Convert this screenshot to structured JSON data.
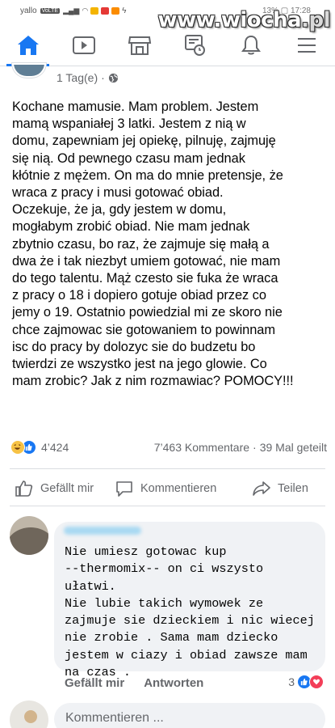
{
  "status_bar": {
    "carrier": "yallo",
    "network_badge": "VoLTE",
    "time": "13% ▢ 17:28"
  },
  "watermark": {
    "text": "www.wiocha",
    "suffix": ".pl"
  },
  "nav": {
    "tabs": [
      {
        "icon": "home-icon",
        "active": true
      },
      {
        "icon": "video-icon",
        "active": false
      },
      {
        "icon": "marketplace-icon",
        "active": false
      },
      {
        "icon": "news-feed-icon",
        "active": false
      },
      {
        "icon": "notifications-bell-icon",
        "active": false
      },
      {
        "icon": "menu-icon",
        "active": false
      }
    ],
    "accent_color": "#1877f2"
  },
  "post": {
    "time": "1 Tag(e)",
    "separator": "·",
    "privacy_icon": "globe-icon",
    "lines": [
      "Kochane mamusie. Mam problem. Jestem",
      "mamą wspaniałej 3 latki. Jestem z nią w",
      "domu, zapewniam jej opiekę, pilnuję, zajmuję",
      "się nią. Od pewnego czasu mam jednak",
      "kłótnie z mężem. On ma do mnie pretensje, że",
      "wraca z pracy i musi gotować obiad.",
      "Oczekuje, że ja, gdy jestem w domu,",
      "mogłabym zrobić obiad. Nie mam jednak",
      "zbytnio czasu, bo raz, że zajmuje się małą a",
      "dwa że i tak niezbyt umiem gotować, nie mam",
      "do tego talentu. Mąż czesto sie fuka że wraca",
      "z pracy o 18 i dopiero gotuje obiad przez co",
      "jemy o 19. Ostatnio powiedzial mi ze skoro nie",
      "chce zajmowac sie gotowaniem to powinnam",
      "isc do pracy by dolozyc sie do budzetu bo",
      "twierdzi ze wszystko jest na jego glowie. Co",
      "mam zrobic? Jak z nim rozmawiac? POMOCY!!!"
    ],
    "reaction_count": "4’424",
    "comments_count": "7’463 Kommentare",
    "dot": "·",
    "shares_count": "39 Mal geteilt"
  },
  "actions": {
    "like": "Gefällt mir",
    "comment": "Kommentieren",
    "share": "Teilen"
  },
  "comment": {
    "text": "Nie umiesz gotowac kup\n--thermomix-- on ci wszysto ułatwi.\nNie lubie takich wymowek ze\nzajmuje sie dzieckiem i nic wiecej\nnie zrobie . Sama mam dziecko\njestem w ciazy i obiad zawsze mam\nna czas .",
    "like_label": "Gefällt mir",
    "reply_label": "Antworten",
    "reaction_count": "3"
  },
  "composer": {
    "placeholder": "Kommentieren ..."
  }
}
